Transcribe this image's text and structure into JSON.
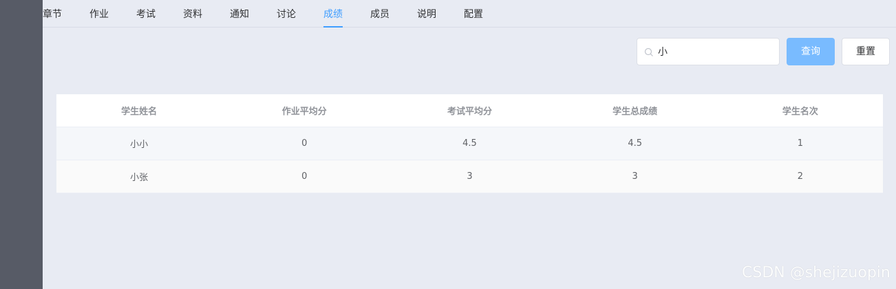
{
  "tabs": [
    "章节",
    "作业",
    "考试",
    "资料",
    "通知",
    "讨论",
    "成绩",
    "成员",
    "说明",
    "配置"
  ],
  "active_tab": "成绩",
  "search": {
    "value": "小",
    "placeholder": ""
  },
  "buttons": {
    "query": "查询",
    "reset": "重置"
  },
  "table": {
    "headers": [
      "学生姓名",
      "作业平均分",
      "考试平均分",
      "学生总成绩",
      "学生名次"
    ],
    "rows": [
      [
        "小小",
        "0",
        "4.5",
        "4.5",
        "1"
      ],
      [
        "小张",
        "0",
        "3",
        "3",
        "2"
      ]
    ]
  },
  "watermark": "CSDN @shejizuopin",
  "colors": {
    "accent": "#409eff",
    "sidebar": "#575b66",
    "background": "#e8ebf3"
  }
}
